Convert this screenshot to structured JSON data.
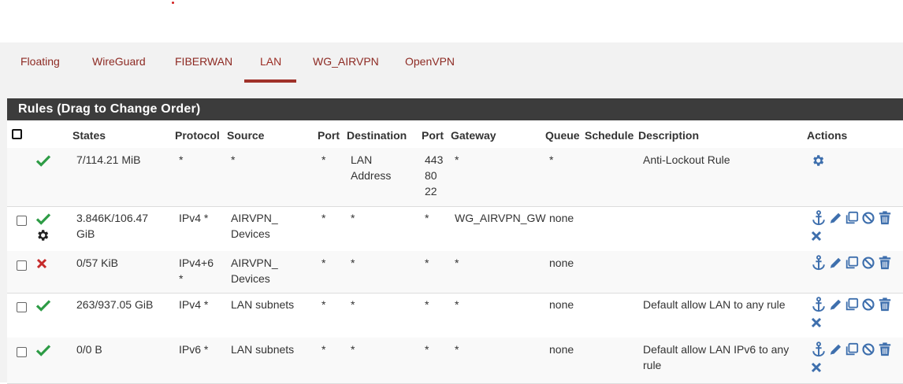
{
  "tabs": [
    "Floating",
    "WireGuard",
    "FIBERWAN",
    "LAN",
    "WG_AIRVPN",
    "OpenVPN"
  ],
  "active_tab": "LAN",
  "panel_title": "Rules (Drag to Change Order)",
  "columns": {
    "states": "States",
    "protocol": "Protocol",
    "source": "Source",
    "port": "Port",
    "destination": "Destination",
    "dest_port": "Port",
    "gateway": "Gateway",
    "queue": "Queue",
    "schedule": "Schedule",
    "description": "Description",
    "actions": "Actions"
  },
  "rows": [
    {
      "status": "pass",
      "states": [
        "7/114.21 MiB"
      ],
      "protocol": [
        "*"
      ],
      "source": [
        "*"
      ],
      "port": "*",
      "destination": [
        "LAN",
        "Address"
      ],
      "dest_port": [
        "443",
        "80",
        "22"
      ],
      "gateway": "*",
      "queue": "*",
      "schedule": "",
      "description": [
        "Anti-Lockout Rule"
      ],
      "action_icons": [
        "gear-icon"
      ]
    },
    {
      "status": "pass",
      "extra_icon": "gear-icon",
      "states": [
        "3.846K/106.47",
        "GiB"
      ],
      "protocol": [
        "IPv4 *"
      ],
      "source": [
        "AIRVPN_",
        "Devices"
      ],
      "port": "*",
      "destination": [
        "*"
      ],
      "dest_port": [
        "*"
      ],
      "gateway": "WG_AIRVPN_GW",
      "queue": "none",
      "schedule": "",
      "description": [
        ""
      ],
      "action_icons": [
        "anchor-icon",
        "pencil-icon",
        "copy-icon",
        "disable-icon",
        "trash-icon",
        "delete-x-icon"
      ]
    },
    {
      "status": "block",
      "states": [
        "0/57 KiB"
      ],
      "protocol": [
        "IPv4+6",
        "*"
      ],
      "source": [
        "AIRVPN_",
        "Devices"
      ],
      "port": "*",
      "destination": [
        "*"
      ],
      "dest_port": [
        "*"
      ],
      "gateway": "*",
      "queue": "none",
      "schedule": "",
      "description": [
        ""
      ],
      "action_icons": [
        "anchor-icon",
        "pencil-icon",
        "copy-icon",
        "disable-icon",
        "trash-icon"
      ]
    },
    {
      "status": "pass",
      "states": [
        "263/937.05 GiB"
      ],
      "protocol": [
        "IPv4 *"
      ],
      "source": [
        "LAN subnets"
      ],
      "port": "*",
      "destination": [
        "*"
      ],
      "dest_port": [
        "*"
      ],
      "gateway": "*",
      "queue": "none",
      "schedule": "",
      "description": [
        "Default allow LAN to any rule"
      ],
      "action_icons": [
        "anchor-icon",
        "pencil-icon",
        "copy-icon",
        "disable-icon",
        "trash-icon",
        "delete-x-icon"
      ]
    },
    {
      "status": "pass",
      "states": [
        "0/0 B"
      ],
      "protocol": [
        "IPv6 *"
      ],
      "source": [
        "LAN subnets"
      ],
      "port": "*",
      "destination": [
        "*"
      ],
      "dest_port": [
        "*"
      ],
      "gateway": "*",
      "queue": "none",
      "schedule": "",
      "description": [
        "Default allow LAN IPv6 to any",
        "rule"
      ],
      "action_icons": [
        "anchor-icon",
        "pencil-icon",
        "copy-icon",
        "disable-icon",
        "trash-icon",
        "delete-x-icon"
      ]
    }
  ],
  "colors": {
    "accent": "#a0322a",
    "link": "#3e6fad",
    "pass": "#2e9c46",
    "block": "#c62b2b",
    "icon_blue": "#3e6fad"
  }
}
